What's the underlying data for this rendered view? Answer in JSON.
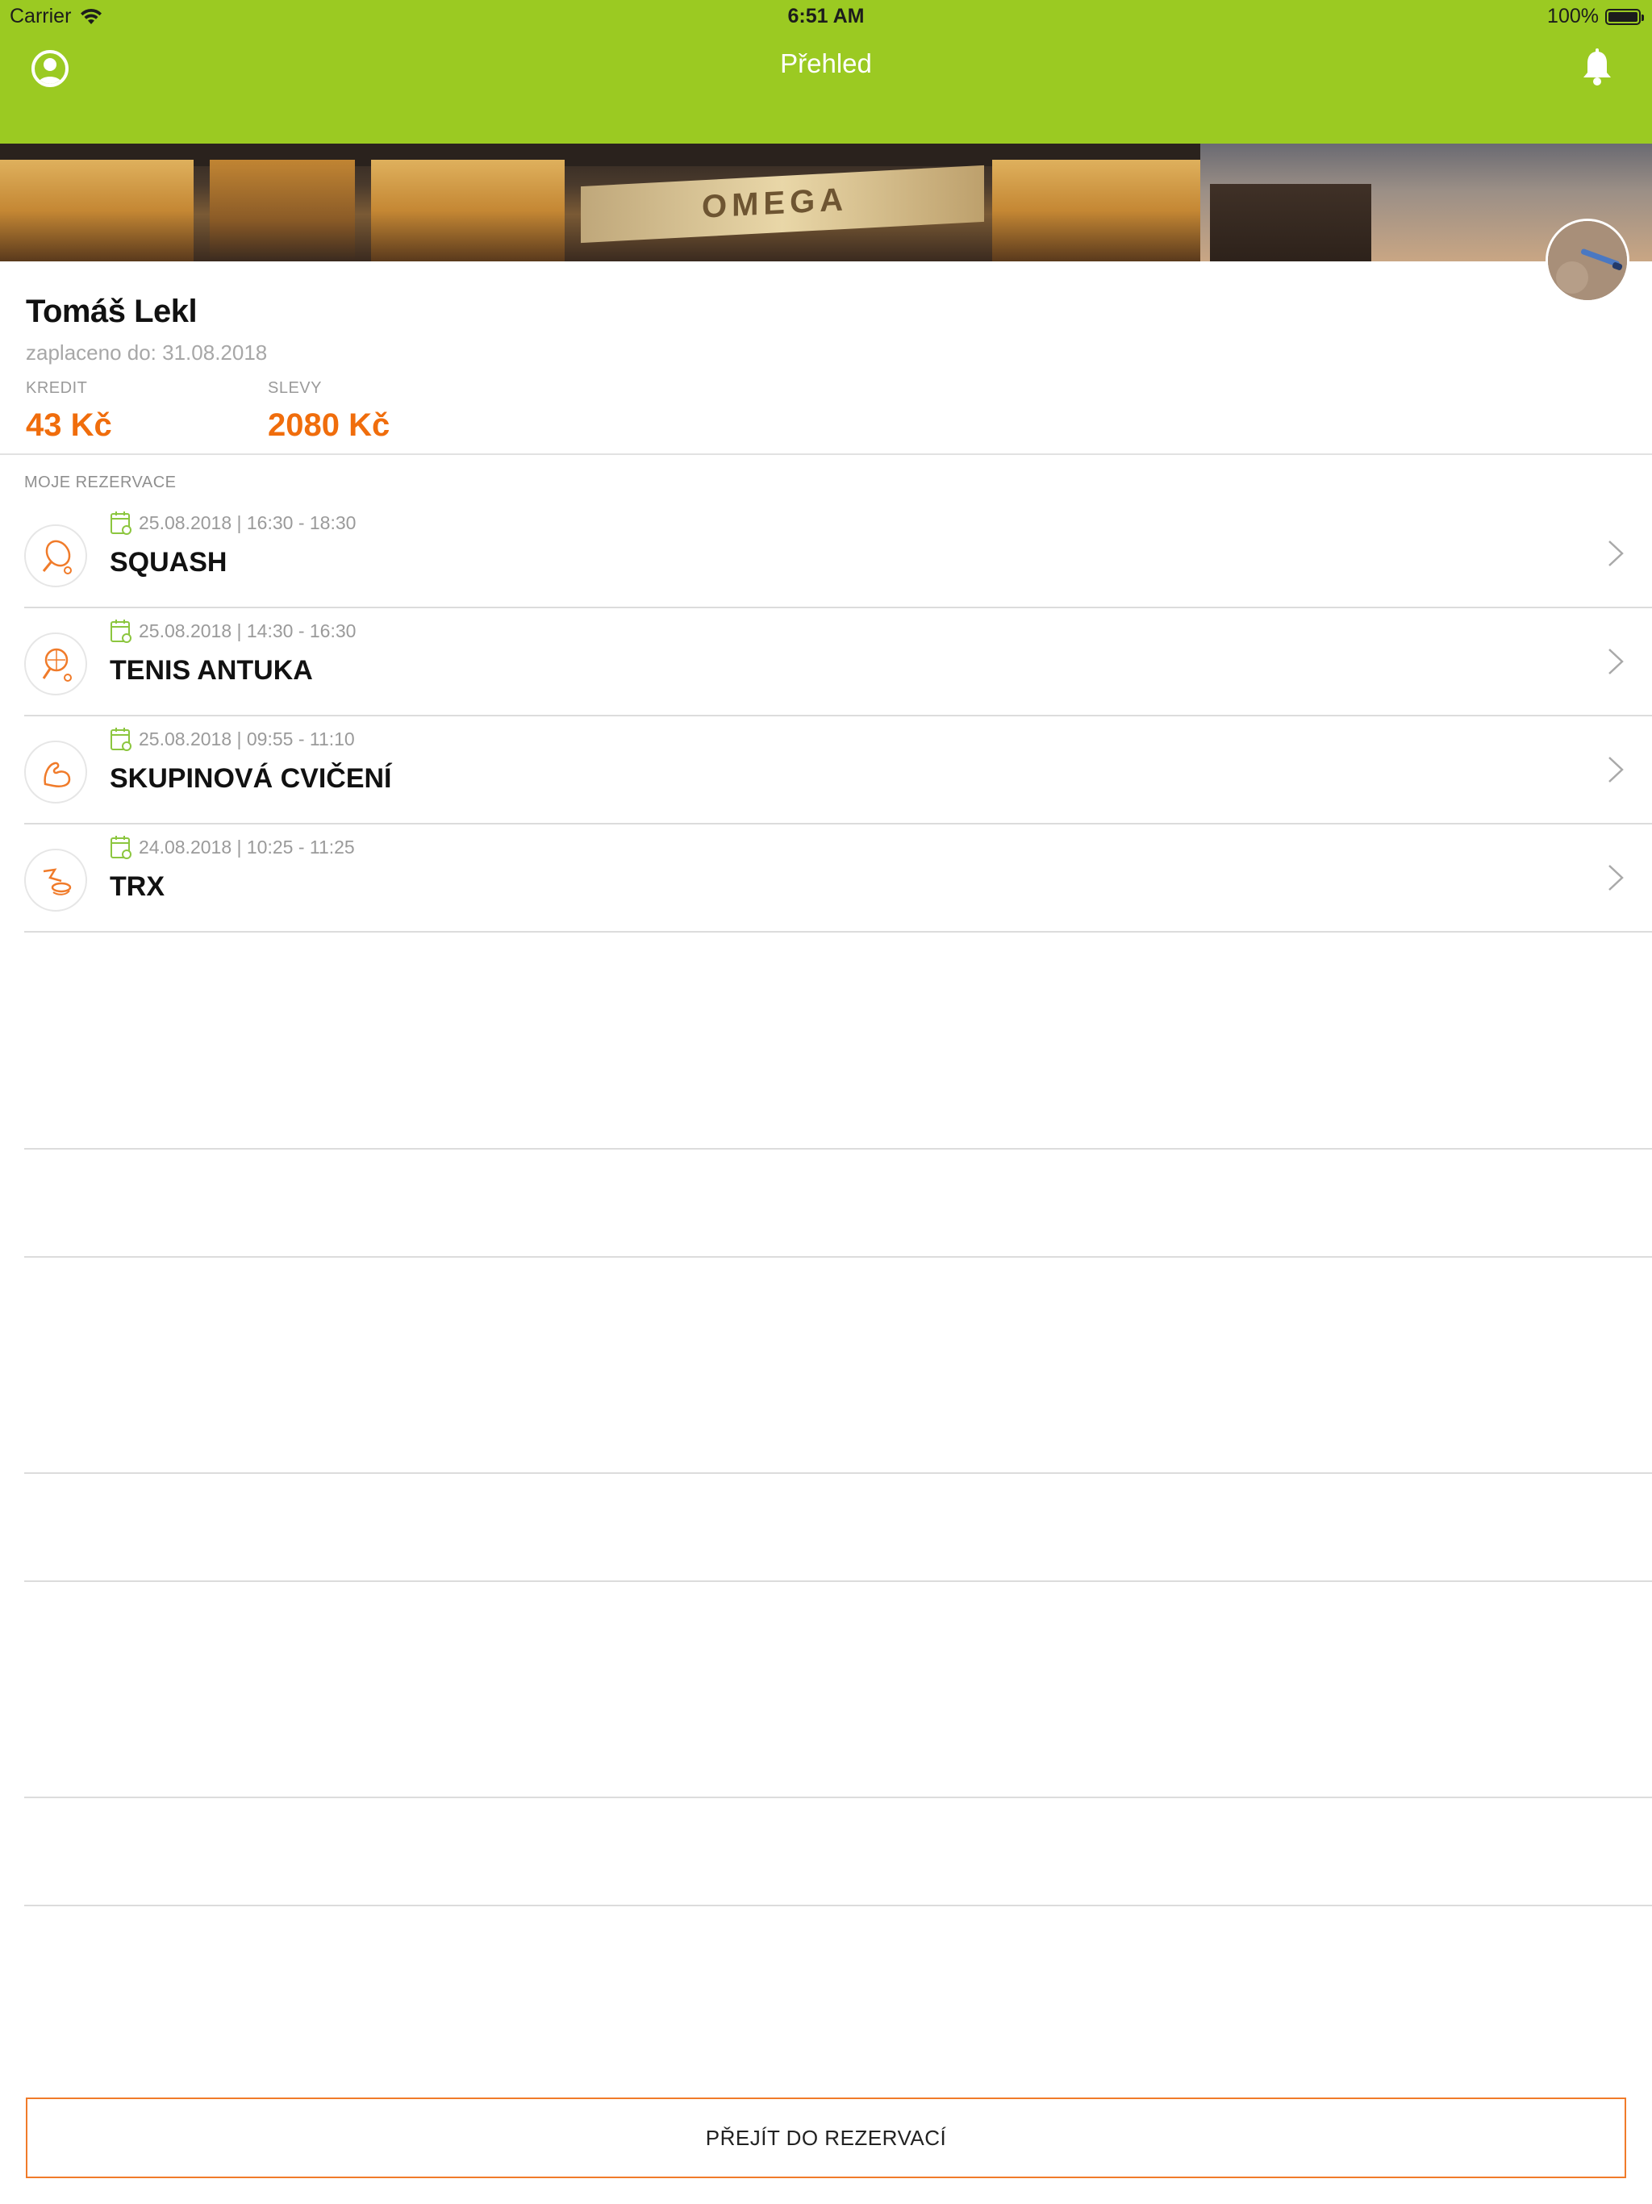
{
  "status_bar": {
    "carrier": "Carrier",
    "time": "6:51 AM",
    "battery": "100%"
  },
  "nav": {
    "title": "Přehled"
  },
  "banner": {
    "logo": "OMEGA"
  },
  "profile": {
    "name": "Tomáš Lekl",
    "paid_until": "zaplaceno do: 31.08.2018",
    "credit_label": "KREDIT",
    "credit_value": "43 Kč",
    "discount_label": "SLEVY",
    "discount_value": "2080 Kč"
  },
  "reservations": {
    "section_title": "MOJE REZERVACE",
    "items": [
      {
        "datetime": "25.08.2018 | 16:30 - 18:30",
        "title": "SQUASH",
        "icon": "squash-icon"
      },
      {
        "datetime": "25.08.2018 | 14:30 - 16:30",
        "title": "TENIS ANTUKA",
        "icon": "tennis-icon"
      },
      {
        "datetime": "25.08.2018 | 09:55 - 11:10",
        "title": "SKUPINOVÁ CVIČENÍ",
        "icon": "muscle-icon"
      },
      {
        "datetime": "24.08.2018 | 10:25 - 11:25",
        "title": "TRX",
        "icon": "trx-icon"
      }
    ]
  },
  "cta": {
    "label": "PŘEJÍT DO REZERVACÍ"
  },
  "colors": {
    "header_green": "#9bca22",
    "accent_orange": "#f06d0c",
    "calendar_green": "#8cc63f"
  }
}
